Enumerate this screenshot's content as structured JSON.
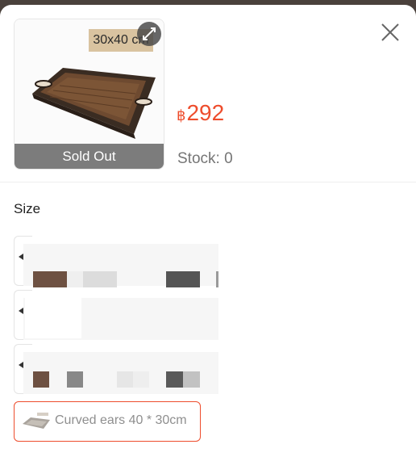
{
  "product": {
    "image_alt": "Rattan serving tray",
    "size_tag": "30x40 cm",
    "sold_out_label": "Sold Out",
    "currency": "฿",
    "price": "292",
    "stock_label": "Stock: 0"
  },
  "variation": {
    "title": "Size",
    "selected_option": "Curved ears 40 * 30cm"
  },
  "colors": {
    "accent": "#ee4d2d",
    "sold_out_bg": "#7c7c7c"
  },
  "icons": {
    "close": "close-icon",
    "expand": "expand-icon"
  }
}
